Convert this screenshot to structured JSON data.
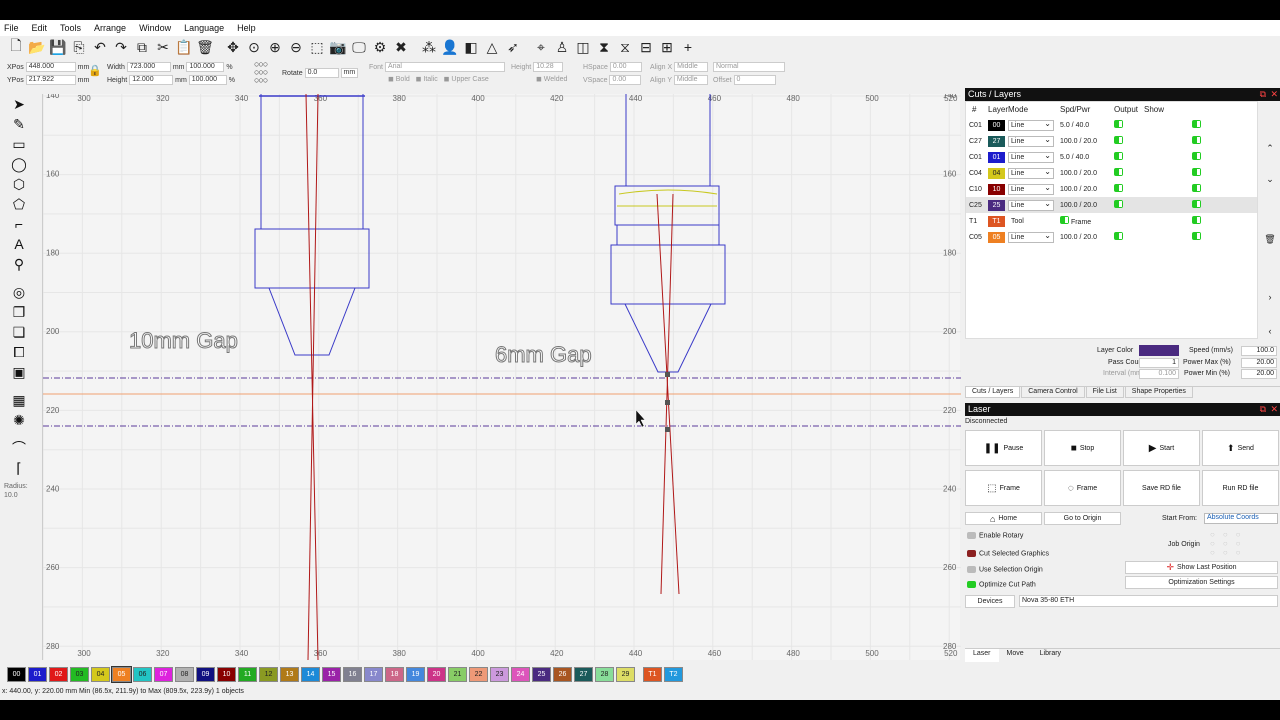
{
  "menu": [
    "File",
    "Edit",
    "Tools",
    "Arrange",
    "Window",
    "Language",
    "Help"
  ],
  "toolbar_icons": [
    "new-file-icon",
    "open-folder-icon",
    "save-icon",
    "import-icon",
    "undo-icon",
    "redo-icon",
    "copy-icon",
    "cut-icon",
    "paste-icon",
    "delete-icon",
    "move-icon",
    "zoom-fit-icon",
    "zoom-in-icon",
    "zoom-out-icon",
    "select-frame-icon",
    "camera-icon",
    "monitor-icon",
    "settings-icon",
    "tools-icon",
    "group-icon",
    "user-icon",
    "flip-h-icon",
    "mirror-icon",
    "cursor-arrow-icon",
    "target-icon",
    "align-center-icon",
    "align-vertical-icon",
    "distribute-h-icon",
    "distribute-v-icon",
    "space-h-icon",
    "grid-icon",
    "crosshair-icon"
  ],
  "props": {
    "xpos_label": "XPos",
    "xpos": "448.000",
    "ypos_label": "YPos",
    "ypos": "217.922",
    "unit": "mm",
    "width_label": "Width",
    "width": "723.000",
    "height_label": "Height",
    "height": "12.000",
    "wpct": "100.000",
    "hpct": "100.000",
    "pct": "%",
    "rotate_label": "Rotate",
    "rotate": "0.0",
    "rot_unit": "mm",
    "font_label": "Font",
    "font": "Arial",
    "fheight_label": "Height",
    "fheight": "10.28",
    "hspace_label": "HSpace",
    "hspace": "0.00",
    "vspace_label": "VSpace",
    "vspace": "0.00",
    "alignx_label": "Align X",
    "alignx": "Middle",
    "aligny_label": "Align Y",
    "aligny": "Middle",
    "normal": "Normal",
    "offset_label": "Offset",
    "offset": "0",
    "bold": "Bold",
    "italic": "Italic",
    "upper": "Upper Case",
    "welded": "Welded"
  },
  "left_tools": [
    "select-arrow-icon",
    "pen-icon",
    "rectangle-icon",
    "ellipse-icon",
    "polygon-icon",
    "pentagon-icon",
    "line-edit-icon",
    "text-icon",
    "position-pin-icon",
    "offset-icon",
    "boolean-icon",
    "copy-array-icon",
    "trace-icon",
    "frame-icon",
    "grid-array-icon",
    "rotary-icon",
    "node-edit-icon",
    "corner-icon"
  ],
  "radius_label": "Radius:",
  "radius_value": "10.0",
  "canvas": {
    "ruler_x": [
      "300",
      "320",
      "340",
      "360",
      "380",
      "400",
      "420",
      "440",
      "460",
      "480",
      "500",
      "520"
    ],
    "ruler_y": [
      "140",
      "160",
      "180",
      "200",
      "220",
      "240",
      "260",
      "280"
    ],
    "label_10mm": "10mm Gap",
    "label_6mm": "6mm Gap"
  },
  "palette": [
    {
      "t": "00",
      "c": "#000000"
    },
    {
      "t": "01",
      "c": "#1c1ccc"
    },
    {
      "t": "02",
      "c": "#e01818"
    },
    {
      "t": "03",
      "c": "#22bb22"
    },
    {
      "t": "04",
      "c": "#d4c81c"
    },
    {
      "t": "05",
      "c": "#ee8022"
    },
    {
      "t": "06",
      "c": "#22c4c4"
    },
    {
      "t": "07",
      "c": "#dd22dd"
    },
    {
      "t": "08",
      "c": "#b0b0b0"
    },
    {
      "t": "09",
      "c": "#101080"
    },
    {
      "t": "10",
      "c": "#880000"
    },
    {
      "t": "11",
      "c": "#22aa22"
    },
    {
      "t": "12",
      "c": "#8a9a22"
    },
    {
      "t": "13",
      "c": "#b07a18"
    },
    {
      "t": "14",
      "c": "#1c8ad8"
    },
    {
      "t": "15",
      "c": "#9a22a8"
    },
    {
      "t": "16",
      "c": "#808090"
    },
    {
      "t": "17",
      "c": "#8888cc"
    },
    {
      "t": "18",
      "c": "#cc6688"
    },
    {
      "t": "19",
      "c": "#4488dd"
    },
    {
      "t": "20",
      "c": "#cc3388"
    },
    {
      "t": "21",
      "c": "#88cc66"
    },
    {
      "t": "22",
      "c": "#ee9977"
    },
    {
      "t": "23",
      "c": "#cc99dd"
    },
    {
      "t": "24",
      "c": "#dd55bb"
    },
    {
      "t": "25",
      "c": "#4a2a80"
    },
    {
      "t": "26",
      "c": "#a85520"
    },
    {
      "t": "27",
      "c": "#1a5a5a"
    },
    {
      "t": "28",
      "c": "#88dd99"
    },
    {
      "t": "29",
      "c": "#dddd66"
    },
    {
      "t": "T1",
      "c": "#dd5522"
    },
    {
      "t": "T2",
      "c": "#2299dd"
    }
  ],
  "status": "x: 440.00, y: 220.00 mm    Min (86.5x, 211.9y) to Max (809.5x, 223.9y)  1 objects",
  "cuts": {
    "title": "Cuts / Layers",
    "headers": [
      "#",
      "Layer",
      "Mode",
      "Spd/Pwr",
      "Output",
      "Show"
    ],
    "rows": [
      {
        "id": "C01",
        "layer": "00",
        "color": "#000000",
        "mode": "Line",
        "sp": "5.0 / 40.0"
      },
      {
        "id": "C27",
        "layer": "27",
        "color": "#1a5a5a",
        "mode": "Line",
        "sp": "100.0 / 20.0"
      },
      {
        "id": "C01",
        "layer": "01",
        "color": "#1c1ccc",
        "mode": "Line",
        "sp": "5.0 / 40.0"
      },
      {
        "id": "C04",
        "layer": "04",
        "color": "#d4c81c",
        "mode": "Line",
        "sp": "100.0 / 20.0"
      },
      {
        "id": "C10",
        "layer": "10",
        "color": "#880000",
        "mode": "Line",
        "sp": "100.0 / 20.0"
      },
      {
        "id": "C25",
        "layer": "25",
        "color": "#4a2a80",
        "mode": "Line",
        "sp": "100.0 / 20.0"
      },
      {
        "id": "T1",
        "layer": "T1",
        "color": "#dd5522",
        "mode": "Tool",
        "sp": "Frame"
      },
      {
        "id": "C05",
        "layer": "05",
        "color": "#ee8022",
        "mode": "Line",
        "sp": "100.0 / 20.0"
      }
    ],
    "layer_color_label": "Layer Color",
    "layer_color": "#4a2a80",
    "pass_count_label": "Pass Count",
    "pass_count": "1",
    "interval_label": "Interval (mm)",
    "interval": "0.100",
    "speed_label": "Speed (mm/s)",
    "speed": "100.0",
    "pmax_label": "Power Max (%)",
    "pmax": "20.00",
    "pmin_label": "Power Min (%)",
    "pmin": "20.00"
  },
  "cuts_tabs": [
    "Cuts / Layers",
    "Camera Control",
    "File List",
    "Shape Properties"
  ],
  "laser": {
    "title": "Laser",
    "state": "Disconnected",
    "pause": "Pause",
    "stop": "Stop",
    "start": "Start",
    "send": "Send",
    "frame1": "Frame",
    "frame2": "Frame",
    "save_rd": "Save RD file",
    "run_rd": "Run RD file",
    "home": "Home",
    "goto": "Go to Origin",
    "start_from_label": "Start From:",
    "start_from": "Absolute Coords",
    "job_origin": "Job Origin",
    "enable_rotary": "Enable Rotary",
    "cut_selected": "Cut Selected Graphics",
    "use_selection": "Use Selection Origin",
    "optimize": "Optimize Cut Path",
    "show_last": "Show Last Position",
    "opt_settings": "Optimization Settings",
    "devices": "Devices",
    "device": "Nova 35-80 ETH"
  },
  "bottom_tabs": [
    "Laser",
    "Move",
    "Library"
  ]
}
